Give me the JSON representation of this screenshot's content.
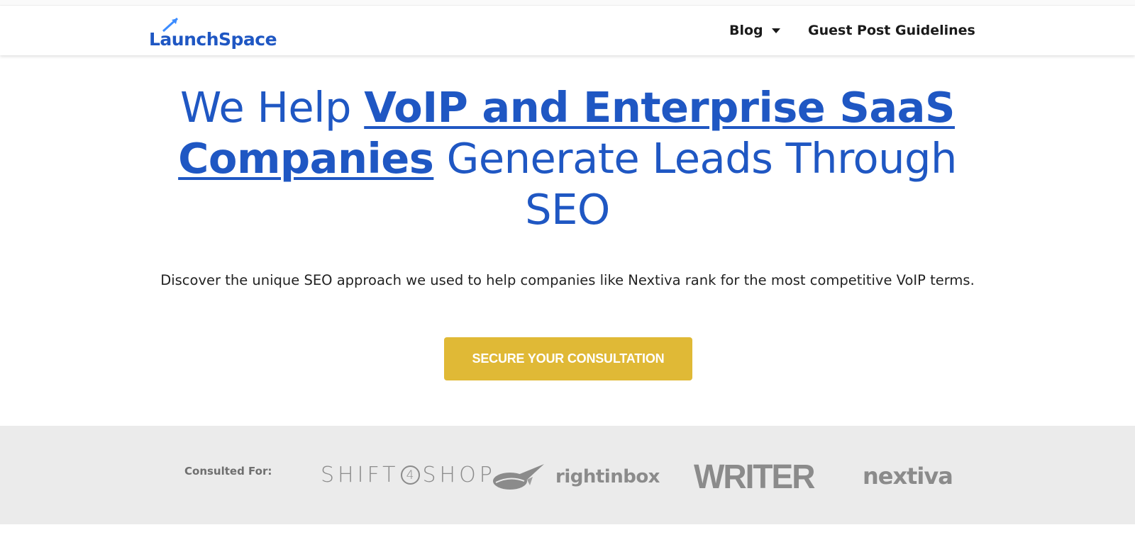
{
  "header": {
    "logo_text": "LaunchSpace",
    "nav": [
      {
        "label": "Blog"
      },
      {
        "label": "Guest Post Guidelines"
      }
    ]
  },
  "hero": {
    "title_prefix": "We Help ",
    "title_link_line1": "VoIP and Enterprise SaaS",
    "title_link_line2": "Companies",
    "title_suffix": " Generate Leads Through SEO",
    "subtitle": "Discover the unique SEO approach we used to help companies like Nextiva rank for the most competitive VoIP terms.",
    "cta_label": "SECURE YOUR CONSULTATION"
  },
  "clients": {
    "label": "Consulted For:",
    "shift_left": "SHIFT",
    "shift_num": "4",
    "shift_right": "SHOP",
    "rightinbox": "rightinbox",
    "writer": "WRITER",
    "nextiva": "nextiva"
  },
  "colors": {
    "brand_blue": "#1f57c3",
    "cta_gold": "#e0b936",
    "band_gray": "#ebebeb",
    "logo_gray": "#8b8b8b"
  }
}
